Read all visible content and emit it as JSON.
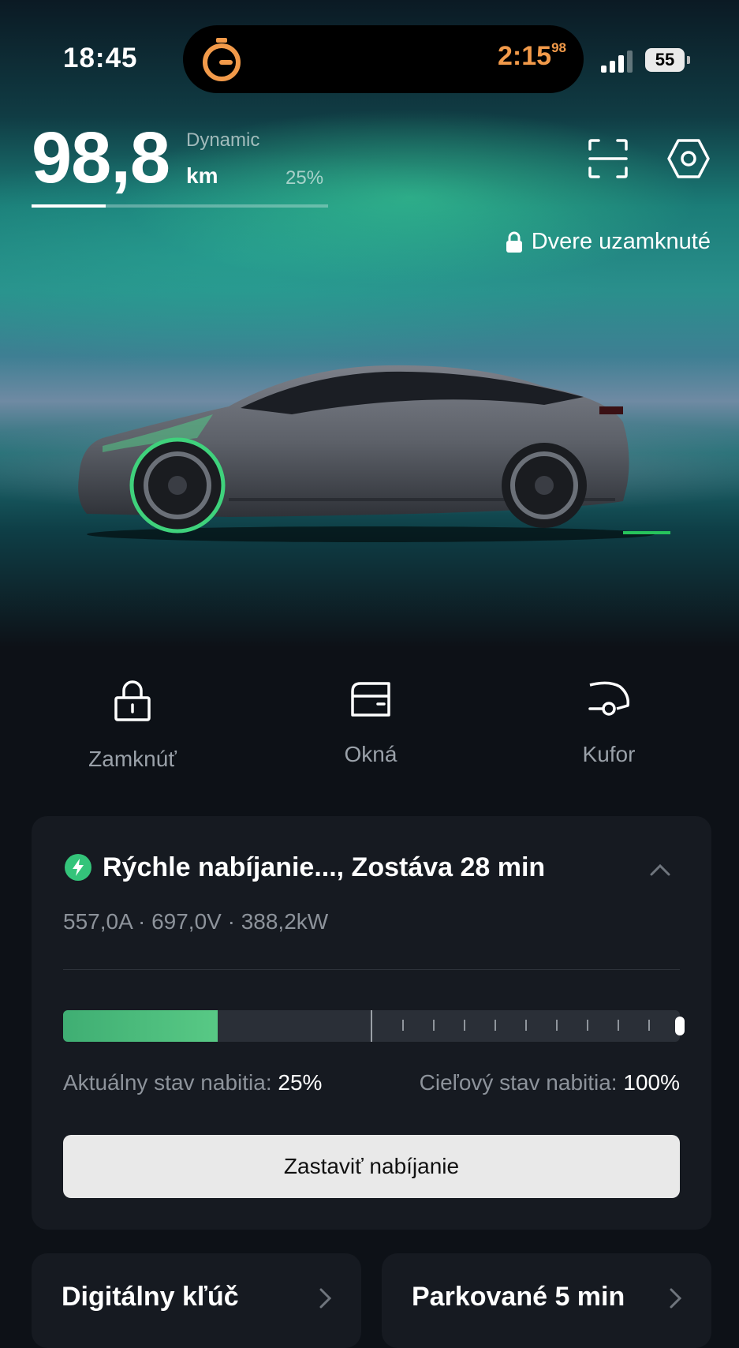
{
  "status_bar": {
    "time": "18:45",
    "timer": "2:15",
    "timer_fraction": "98",
    "battery": "55",
    "signal_bars": 3,
    "stopwatch_icon": "stopwatch-icon",
    "accent": "#f29a4a"
  },
  "range": {
    "value": "98,8",
    "unit": "km",
    "mode": "Dynamic",
    "percent": "25%",
    "fill_fraction": 0.25
  },
  "door_status": {
    "icon": "lock-icon",
    "label": "Dvere uzamknuté"
  },
  "actions": [
    {
      "icon": "lock-icon",
      "label": "Zamknúť"
    },
    {
      "icon": "window-icon",
      "label": "Okná"
    },
    {
      "icon": "trunk-icon",
      "label": "Kufor"
    }
  ],
  "charging": {
    "title": "Rýchle nabíjanie...,  Zostáva 28 min",
    "stats": "557,0A · 697,0V · 388,2kW",
    "current_label": "Aktuálny stav nabitia:",
    "current_value": "25%",
    "target_label": "Cieľový stav nabitia:",
    "target_value": "100%",
    "current_fraction": 0.25,
    "target_fraction": 1.0,
    "stop_button": "Zastaviť nabíjanie",
    "fill_color": "#58c985"
  },
  "tiles": [
    {
      "label": "Digitálny kľúč"
    },
    {
      "label": "Parkované 5 min"
    }
  ]
}
